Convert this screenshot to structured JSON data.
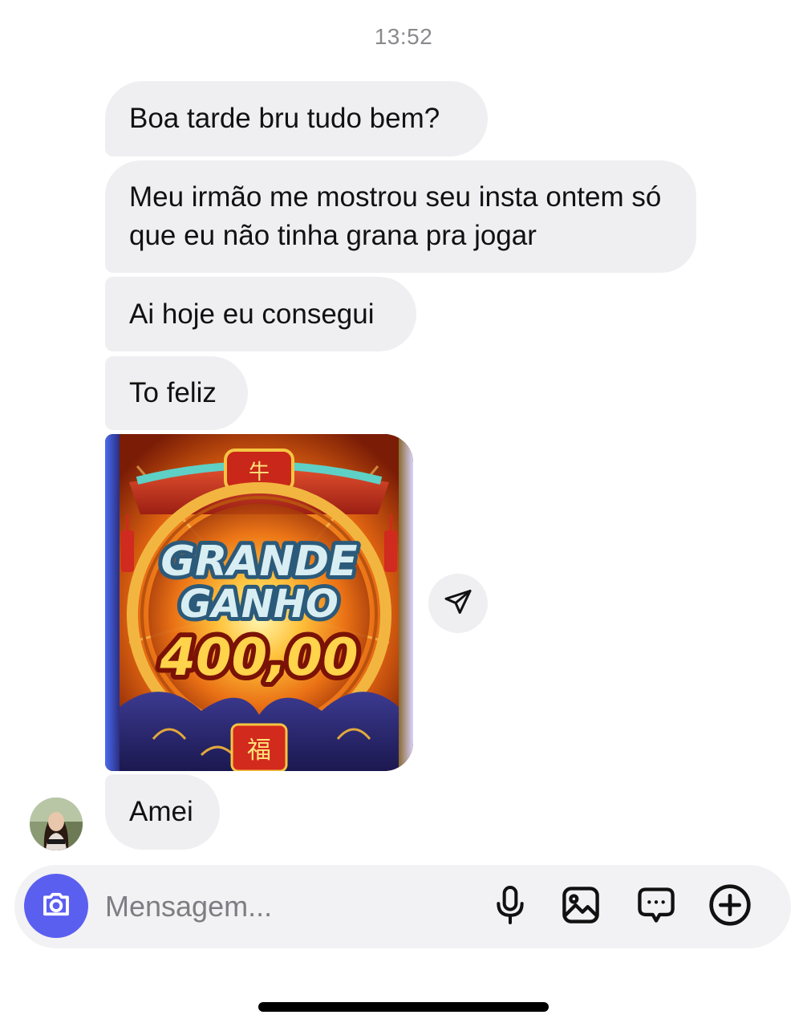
{
  "conversation": {
    "timestamp": "13:52",
    "messages": [
      {
        "text": "Boa tarde bru tudo bem?"
      },
      {
        "text": "Meu irmão me mostrou seu insta ontem só que eu não tinha grana pra jogar"
      },
      {
        "text": "Ai hoje eu consegui"
      },
      {
        "text": "To feliz"
      },
      {
        "text": "Amei"
      }
    ],
    "image_message": {
      "title_line1": "GRANDE",
      "title_line2": "GANHO",
      "amount": "400,00",
      "badge_top": "牛",
      "badge_bottom": "福"
    }
  },
  "icons": {
    "share": "paper-plane-icon",
    "camera": "camera-icon",
    "mic": "microphone-icon",
    "gallery": "image-icon",
    "sticker": "chat-bubble-icon",
    "plus": "plus-circle-icon"
  },
  "composer": {
    "placeholder": "Mensagem..."
  },
  "colors": {
    "bubble_bg": "#efeff2",
    "accent": "#5b5ff0",
    "timestamp": "#8a8a8e"
  }
}
